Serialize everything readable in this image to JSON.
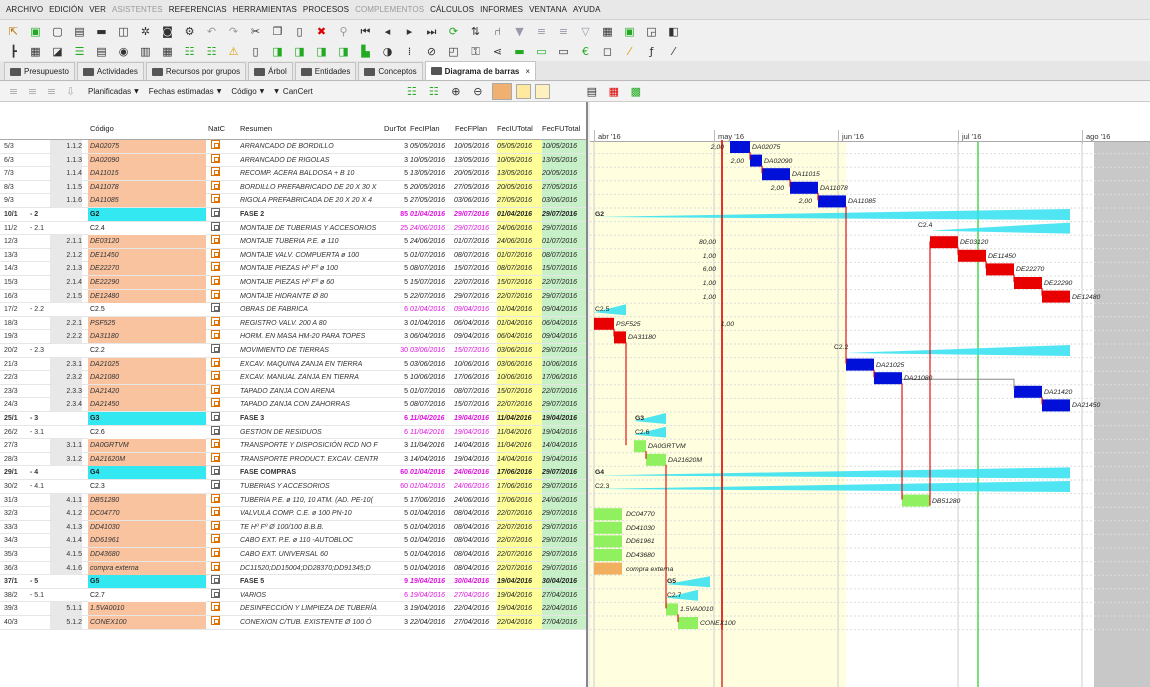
{
  "menu": [
    "ARCHIVO",
    "EDICIÓN",
    "VER",
    "ASISTENTES",
    "REFERENCIAS",
    "HERRAMIENTAS",
    "PROCESOS",
    "COMPLEMENTOS",
    "CÁLCULOS",
    "INFORMES",
    "VENTANA",
    "AYUDA"
  ],
  "menu_disabled": [
    "ASISTENTES",
    "COMPLEMENTOS"
  ],
  "tabs": [
    {
      "label": "Presupuesto",
      "active": false
    },
    {
      "label": "Actividades",
      "active": false
    },
    {
      "label": "Recursos por grupos",
      "active": false
    },
    {
      "label": "Árbol",
      "active": false
    },
    {
      "label": "Entidades",
      "active": false
    },
    {
      "label": "Conceptos",
      "active": false
    },
    {
      "label": "Diagrama de barras",
      "active": true,
      "close": "×"
    }
  ],
  "filters": {
    "planificadas": "Planificadas",
    "fechas": "Fechas estimadas",
    "codigo": "Código",
    "cancert": "CanCert"
  },
  "columns": [
    "Código",
    "NatC",
    "Resumen",
    "DurTot",
    "FecIPlan",
    "FecFPlan",
    "FecIUTotal",
    "FecFUTotal"
  ],
  "colors": {
    "orange_code": "#f9c3a0",
    "cyan_group": "#33e8f0",
    "pink_text": "#e010e0",
    "yellow_date": "#ffff99",
    "green_date": "#c8f0c8",
    "blue_bar": "#0010d8",
    "red_bar": "#e80000",
    "green_bar": "#90f060",
    "cyan_bar": "#30e0f0",
    "orange_bar": "#f0b060",
    "gantt_shade": "#ffffe0"
  },
  "rows": [
    {
      "n": "5/3",
      "lvl": "",
      "num": "1.1.2",
      "code": "DA02075",
      "type": "task",
      "resumen": "ARRANCADO DE BORDILLO",
      "dur": "3",
      "fip": "05/05/2016",
      "ffp": "10/05/2016",
      "fiu": "05/05/2016",
      "ffu": "10/05/2016"
    },
    {
      "n": "6/3",
      "lvl": "",
      "num": "1.1.3",
      "code": "DA02090",
      "type": "task",
      "resumen": "ARRANCADO DE RIGOLAS",
      "dur": "3",
      "fip": "10/05/2016",
      "ffp": "13/05/2016",
      "fiu": "10/05/2016",
      "ffu": "13/05/2016"
    },
    {
      "n": "7/3",
      "lvl": "",
      "num": "1.1.4",
      "code": "DA11015",
      "type": "task",
      "resumen": "RECOMP. ACERA BALDOSA + B 10",
      "dur": "5",
      "fip": "13/05/2016",
      "ffp": "20/05/2016",
      "fiu": "13/05/2016",
      "ffu": "20/05/2016"
    },
    {
      "n": "8/3",
      "lvl": "",
      "num": "1.1.5",
      "code": "DA11078",
      "type": "task",
      "resumen": "BORDILLO PREFABRICADO DE 20 X 30 X",
      "dur": "5",
      "fip": "20/05/2016",
      "ffp": "27/05/2016",
      "fiu": "20/05/2016",
      "ffu": "27/05/2016"
    },
    {
      "n": "9/3",
      "lvl": "",
      "num": "1.1.6",
      "code": "DA11085",
      "type": "task",
      "resumen": "RIGOLA PREFABRICADA DE 20 X 20 X 4",
      "dur": "5",
      "fip": "27/05/2016",
      "ffp": "03/06/2016",
      "fiu": "27/05/2016",
      "ffu": "03/06/2016"
    },
    {
      "n": "10/1",
      "lvl": "- 2",
      "num": "",
      "code": "G2",
      "type": "group",
      "resumen": "FASE 2",
      "dur": "85",
      "fip": "01/04/2016",
      "ffp": "29/07/2016",
      "fiu": "01/04/2016",
      "ffu": "29/07/2016"
    },
    {
      "n": "11/2",
      "lvl": "- 2.1",
      "num": "",
      "code": "C2.4",
      "type": "sub",
      "resumen": "MONTAJE DE TUBERIAS Y ACCESORIOS",
      "dur": "25",
      "fip": "24/06/2016",
      "ffp": "29/07/2016",
      "fiu": "24/06/2016",
      "ffu": "29/07/2016"
    },
    {
      "n": "12/3",
      "lvl": "",
      "num": "2.1.1",
      "code": "DE03120",
      "type": "task",
      "resumen": "MONTAJE TUBERIA P.E. ø 110",
      "dur": "5",
      "fip": "24/06/2016",
      "ffp": "01/07/2016",
      "fiu": "24/06/2016",
      "ffu": "01/07/2016"
    },
    {
      "n": "13/3",
      "lvl": "",
      "num": "2.1.2",
      "code": "DE11450",
      "type": "task",
      "resumen": "MONTAJE VALV. COMPUERTA ø 100",
      "dur": "5",
      "fip": "01/07/2016",
      "ffp": "08/07/2016",
      "fiu": "01/07/2016",
      "ffu": "08/07/2016"
    },
    {
      "n": "14/3",
      "lvl": "",
      "num": "2.1.3",
      "code": "DE22270",
      "type": "task",
      "resumen": "MONTAJE PIEZAS Hº Fº ø 100",
      "dur": "5",
      "fip": "08/07/2016",
      "ffp": "15/07/2016",
      "fiu": "08/07/2016",
      "ffu": "15/07/2016"
    },
    {
      "n": "15/3",
      "lvl": "",
      "num": "2.1.4",
      "code": "DE22290",
      "type": "task",
      "resumen": "MONTAJE PIEZAS Hº Fº ø 60",
      "dur": "5",
      "fip": "15/07/2016",
      "ffp": "22/07/2016",
      "fiu": "15/07/2016",
      "ffu": "22/07/2016"
    },
    {
      "n": "16/3",
      "lvl": "",
      "num": "2.1.5",
      "code": "DE12480",
      "type": "task",
      "resumen": "MONTAJE HIDRANTE Ø 80",
      "dur": "5",
      "fip": "22/07/2016",
      "ffp": "29/07/2016",
      "fiu": "22/07/2016",
      "ffu": "29/07/2016"
    },
    {
      "n": "17/2",
      "lvl": "- 2.2",
      "num": "",
      "code": "C2.5",
      "type": "sub",
      "resumen": "OBRAS DE FABRICA",
      "dur": "6",
      "fip": "01/04/2016",
      "ffp": "09/04/2016",
      "fiu": "01/04/2016",
      "ffu": "09/04/2016"
    },
    {
      "n": "18/3",
      "lvl": "",
      "num": "2.2.1",
      "code": "PSF525",
      "type": "task",
      "resumen": "REGISTRO VALV. 200 A 80",
      "dur": "3",
      "fip": "01/04/2016",
      "ffp": "06/04/2016",
      "fiu": "01/04/2016",
      "ffu": "06/04/2016"
    },
    {
      "n": "19/3",
      "lvl": "",
      "num": "2.2.2",
      "code": "DA31180",
      "type": "task",
      "resumen": "HORM. EN MASA HM-20 PARA TOPES",
      "dur": "3",
      "fip": "06/04/2016",
      "ffp": "09/04/2016",
      "fiu": "06/04/2016",
      "ffu": "09/04/2016"
    },
    {
      "n": "20/2",
      "lvl": "- 2.3",
      "num": "",
      "code": "C2.2",
      "type": "sub",
      "resumen": "MOVIMIENTO DE TIERRAS",
      "dur": "30",
      "fip": "03/06/2016",
      "ffp": "15/07/2016",
      "fiu": "03/06/2016",
      "ffu": "29/07/2016"
    },
    {
      "n": "21/3",
      "lvl": "",
      "num": "2.3.1",
      "code": "DA21025",
      "type": "task",
      "resumen": "EXCAV. MAQUINA ZANJA EN TIERRA",
      "dur": "5",
      "fip": "03/06/2016",
      "ffp": "10/06/2016",
      "fiu": "03/06/2016",
      "ffu": "10/06/2016"
    },
    {
      "n": "22/3",
      "lvl": "",
      "num": "2.3.2",
      "code": "DA21080",
      "type": "task",
      "resumen": "EXCAV. MANUAL ZANJA EN TIERRA",
      "dur": "5",
      "fip": "10/06/2016",
      "ffp": "17/06/2016",
      "fiu": "10/06/2016",
      "ffu": "17/06/2016"
    },
    {
      "n": "23/3",
      "lvl": "",
      "num": "2.3.3",
      "code": "DA21420",
      "type": "task",
      "resumen": "TAPADO ZANJA CON ARENA",
      "dur": "5",
      "fip": "01/07/2016",
      "ffp": "08/07/2016",
      "fiu": "15/07/2016",
      "ffu": "22/07/2016"
    },
    {
      "n": "24/3",
      "lvl": "",
      "num": "2.3.4",
      "code": "DA21450",
      "type": "task",
      "resumen": "TAPADO ZANJA CON ZAHORRAS",
      "dur": "5",
      "fip": "08/07/2016",
      "ffp": "15/07/2016",
      "fiu": "22/07/2016",
      "ffu": "29/07/2016"
    },
    {
      "n": "25/1",
      "lvl": "- 3",
      "num": "",
      "code": "G3",
      "type": "group",
      "resumen": "FASE 3",
      "dur": "6",
      "fip": "11/04/2016",
      "ffp": "19/04/2016",
      "fiu": "11/04/2016",
      "ffu": "19/04/2016"
    },
    {
      "n": "26/2",
      "lvl": "- 3.1",
      "num": "",
      "code": "C2.6",
      "type": "sub",
      "resumen": "GESTION DE RESIDUOS",
      "dur": "6",
      "fip": "11/04/2016",
      "ffp": "19/04/2016",
      "fiu": "11/04/2016",
      "ffu": "19/04/2016"
    },
    {
      "n": "27/3",
      "lvl": "",
      "num": "3.1.1",
      "code": "DA0GRTVM",
      "type": "task",
      "resumen": "TRANSPORTE Y DISPOSICIÓN RCD NO F",
      "dur": "3",
      "fip": "11/04/2016",
      "ffp": "14/04/2016",
      "fiu": "11/04/2016",
      "ffu": "14/04/2016"
    },
    {
      "n": "28/3",
      "lvl": "",
      "num": "3.1.2",
      "code": "DA21620M",
      "type": "task",
      "resumen": "TRANSPORTE PRODUCT. EXCAV. CENTR",
      "dur": "3",
      "fip": "14/04/2016",
      "ffp": "19/04/2016",
      "fiu": "14/04/2016",
      "ffu": "19/04/2016"
    },
    {
      "n": "29/1",
      "lvl": "- 4",
      "num": "",
      "code": "G4",
      "type": "group",
      "resumen": "FASE COMPRAS",
      "dur": "60",
      "fip": "01/04/2016",
      "ffp": "24/06/2016",
      "fiu": "17/06/2016",
      "ffu": "29/07/2016"
    },
    {
      "n": "30/2",
      "lvl": "- 4.1",
      "num": "",
      "code": "C2.3",
      "type": "sub",
      "resumen": "TUBERIAS Y ACCESORIOS",
      "dur": "60",
      "fip": "01/04/2016",
      "ffp": "24/06/2016",
      "fiu": "17/06/2016",
      "ffu": "29/07/2016"
    },
    {
      "n": "31/3",
      "lvl": "",
      "num": "4.1.1",
      "code": "DB51280",
      "type": "task",
      "resumen": "TUBERIA P.E. ø 110, 10 ATM. (AD. PE-10(",
      "dur": "5",
      "fip": "17/06/2016",
      "ffp": "24/06/2016",
      "fiu": "17/06/2016",
      "ffu": "24/06/2016"
    },
    {
      "n": "32/3",
      "lvl": "",
      "num": "4.1.2",
      "code": "DC04770",
      "type": "task",
      "resumen": "VALVULA COMP. C.E. ø 100 PN-10",
      "dur": "5",
      "fip": "01/04/2016",
      "ffp": "08/04/2016",
      "fiu": "22/07/2016",
      "ffu": "29/07/2016"
    },
    {
      "n": "33/3",
      "lvl": "",
      "num": "4.1.3",
      "code": "DD41030",
      "type": "task",
      "resumen": "TE Hº Fº Ø 100/100 B.B.B.",
      "dur": "5",
      "fip": "01/04/2016",
      "ffp": "08/04/2016",
      "fiu": "22/07/2016",
      "ffu": "29/07/2016"
    },
    {
      "n": "34/3",
      "lvl": "",
      "num": "4.1.4",
      "code": "DD61961",
      "type": "task",
      "resumen": "CABO EXT. P.E. ø 110 -AUTOBLOC",
      "dur": "5",
      "fip": "01/04/2016",
      "ffp": "08/04/2016",
      "fiu": "22/07/2016",
      "ffu": "29/07/2016"
    },
    {
      "n": "35/3",
      "lvl": "",
      "num": "4.1.5",
      "code": "DD43680",
      "type": "task",
      "resumen": "CABO EXT. UNIVERSAL 60",
      "dur": "5",
      "fip": "01/04/2016",
      "ffp": "08/04/2016",
      "fiu": "22/07/2016",
      "ffu": "29/07/2016"
    },
    {
      "n": "36/3",
      "lvl": "",
      "num": "4.1.6",
      "code": "compra externa",
      "type": "task",
      "resumen": "DC11520;DD15004;DD28370;DD91345;D",
      "dur": "5",
      "fip": "01/04/2016",
      "ffp": "08/04/2016",
      "fiu": "22/07/2016",
      "ffu": "29/07/2016"
    },
    {
      "n": "37/1",
      "lvl": "- 5",
      "num": "",
      "code": "G5",
      "type": "group",
      "resumen": "FASE 5",
      "dur": "9",
      "fip": "19/04/2016",
      "ffp": "30/04/2016",
      "fiu": "19/04/2016",
      "ffu": "30/04/2016"
    },
    {
      "n": "38/2",
      "lvl": "- 5.1",
      "num": "",
      "code": "C2.7",
      "type": "sub",
      "resumen": "VARIOS",
      "dur": "6",
      "fip": "19/04/2016",
      "ffp": "27/04/2016",
      "fiu": "19/04/2016",
      "ffu": "27/04/2016"
    },
    {
      "n": "39/3",
      "lvl": "",
      "num": "5.1.1",
      "code": "1.5VA0010",
      "type": "task",
      "resumen": "DESINFECCIÓN Y LIMPIEZA DE TUBERÍA",
      "dur": "3",
      "fip": "19/04/2016",
      "ffp": "22/04/2016",
      "fiu": "19/04/2016",
      "ffu": "22/04/2016"
    },
    {
      "n": "40/3",
      "lvl": "",
      "num": "5.1.2",
      "code": "CONEX100",
      "type": "task",
      "resumen": "CONEXION C/TUB. EXISTENTE Ø 100 Ó",
      "dur": "3",
      "fip": "22/04/2016",
      "ffp": "27/04/2016",
      "fiu": "22/04/2016",
      "ffu": "27/04/2016"
    }
  ],
  "gantt": {
    "months": [
      "abr '16",
      "may '16",
      "jun '16",
      "jul '16",
      "ago '16"
    ],
    "bars": [
      {
        "row": 0,
        "start": "2016-05-05",
        "end": "2016-05-10",
        "color": "blue",
        "label": "DA02075",
        "val": "2,00"
      },
      {
        "row": 1,
        "start": "2016-05-10",
        "end": "2016-05-13",
        "color": "blue",
        "label": "DA02090",
        "val": "2,00"
      },
      {
        "row": 2,
        "start": "2016-05-13",
        "end": "2016-05-20",
        "color": "blue",
        "label": "DA11015",
        "val": ""
      },
      {
        "row": 3,
        "start": "2016-05-20",
        "end": "2016-05-27",
        "color": "blue",
        "label": "DA11078",
        "val": "2,00"
      },
      {
        "row": 4,
        "start": "2016-05-27",
        "end": "2016-06-03",
        "color": "blue",
        "label": "DA11085",
        "val": "2,00"
      },
      {
        "row": 5,
        "start": "2016-04-01",
        "end": "2016-07-29",
        "color": "cyan",
        "label": "G2",
        "val": "",
        "summary": true
      },
      {
        "row": 6,
        "start": "2016-06-24",
        "end": "2016-07-29",
        "color": "cyan",
        "label": "C2.4",
        "val": "",
        "summary": true,
        "labelabove": true
      },
      {
        "row": 7,
        "start": "2016-06-24",
        "end": "2016-07-01",
        "color": "red",
        "label": "DE03120",
        "val": "80,00"
      },
      {
        "row": 8,
        "start": "2016-07-01",
        "end": "2016-07-08",
        "color": "red",
        "label": "DE11450",
        "val": "1,00"
      },
      {
        "row": 9,
        "start": "2016-07-08",
        "end": "2016-07-15",
        "color": "red",
        "label": "DE22270",
        "val": "6,00"
      },
      {
        "row": 10,
        "start": "2016-07-15",
        "end": "2016-07-22",
        "color": "red",
        "label": "DE22290",
        "val": "1,00"
      },
      {
        "row": 11,
        "start": "2016-07-22",
        "end": "2016-07-29",
        "color": "red",
        "label": "DE12480",
        "val": "1,00"
      },
      {
        "row": 12,
        "start": "2016-04-01",
        "end": "2016-04-09",
        "color": "cyan",
        "label": "C2.5",
        "val": "",
        "summary": true
      },
      {
        "row": 13,
        "start": "2016-04-01",
        "end": "2016-04-06",
        "color": "red",
        "label": "PSF525",
        "val": "1,00"
      },
      {
        "row": 14,
        "start": "2016-04-06",
        "end": "2016-04-09",
        "color": "red",
        "label": "DA31180",
        "val": ""
      },
      {
        "row": 15,
        "start": "2016-06-03",
        "end": "2016-07-29",
        "color": "cyan",
        "label": "C2.2",
        "val": "",
        "summary": true,
        "labelabove": true
      },
      {
        "row": 16,
        "start": "2016-06-03",
        "end": "2016-06-10",
        "color": "blue",
        "label": "DA21025",
        "val": ""
      },
      {
        "row": 17,
        "start": "2016-06-10",
        "end": "2016-06-17",
        "color": "blue",
        "label": "DA21080",
        "val": ""
      },
      {
        "row": 18,
        "start": "2016-07-15",
        "end": "2016-07-22",
        "color": "blue",
        "label": "DA21420",
        "val": ""
      },
      {
        "row": 19,
        "start": "2016-07-22",
        "end": "2016-07-29",
        "color": "blue",
        "label": "DA21450",
        "val": ""
      },
      {
        "row": 20,
        "start": "2016-04-11",
        "end": "2016-04-19",
        "color": "cyan",
        "label": "G3",
        "val": "",
        "summary": true
      },
      {
        "row": 21,
        "start": "2016-04-11",
        "end": "2016-04-19",
        "color": "cyan",
        "label": "C2.6",
        "val": "",
        "summary": true
      },
      {
        "row": 22,
        "start": "2016-04-11",
        "end": "2016-04-14",
        "color": "green",
        "label": "DA0GRTVM",
        "val": ""
      },
      {
        "row": 23,
        "start": "2016-04-14",
        "end": "2016-04-19",
        "color": "green",
        "label": "DA21620M",
        "val": ""
      },
      {
        "row": 24,
        "start": "2016-04-01",
        "end": "2016-07-29",
        "color": "cyan",
        "label": "G4",
        "val": "",
        "summary": true
      },
      {
        "row": 25,
        "start": "2016-04-01",
        "end": "2016-07-29",
        "color": "cyan",
        "label": "C2.3",
        "val": "",
        "summary": true
      },
      {
        "row": 26,
        "start": "2016-06-17",
        "end": "2016-06-24",
        "color": "green",
        "label": "DB51280",
        "val": ""
      },
      {
        "row": 27,
        "start": "2016-04-01",
        "end": "2016-04-08",
        "color": "green",
        "label": "DC04770",
        "val": ""
      },
      {
        "row": 28,
        "start": "2016-04-01",
        "end": "2016-04-08",
        "color": "green",
        "label": "DD41030",
        "val": ""
      },
      {
        "row": 29,
        "start": "2016-04-01",
        "end": "2016-04-08",
        "color": "green",
        "label": "DD61961",
        "val": ""
      },
      {
        "row": 30,
        "start": "2016-04-01",
        "end": "2016-04-08",
        "color": "green",
        "label": "DD43680",
        "val": ""
      },
      {
        "row": 31,
        "start": "2016-04-01",
        "end": "2016-04-08",
        "color": "orange",
        "label": "compra externa",
        "val": ""
      },
      {
        "row": 32,
        "start": "2016-04-19",
        "end": "2016-04-30",
        "color": "cyan",
        "label": "G5",
        "val": "",
        "summary": true
      },
      {
        "row": 33,
        "start": "2016-04-19",
        "end": "2016-04-27",
        "color": "cyan",
        "label": "C2.7",
        "val": "",
        "summary": true
      },
      {
        "row": 34,
        "start": "2016-04-19",
        "end": "2016-04-22",
        "color": "green",
        "label": "1.5VA0010",
        "val": ""
      },
      {
        "row": 35,
        "start": "2016-04-22",
        "end": "2016-04-27",
        "color": "green",
        "label": "CONEX100",
        "val": ""
      }
    ]
  }
}
